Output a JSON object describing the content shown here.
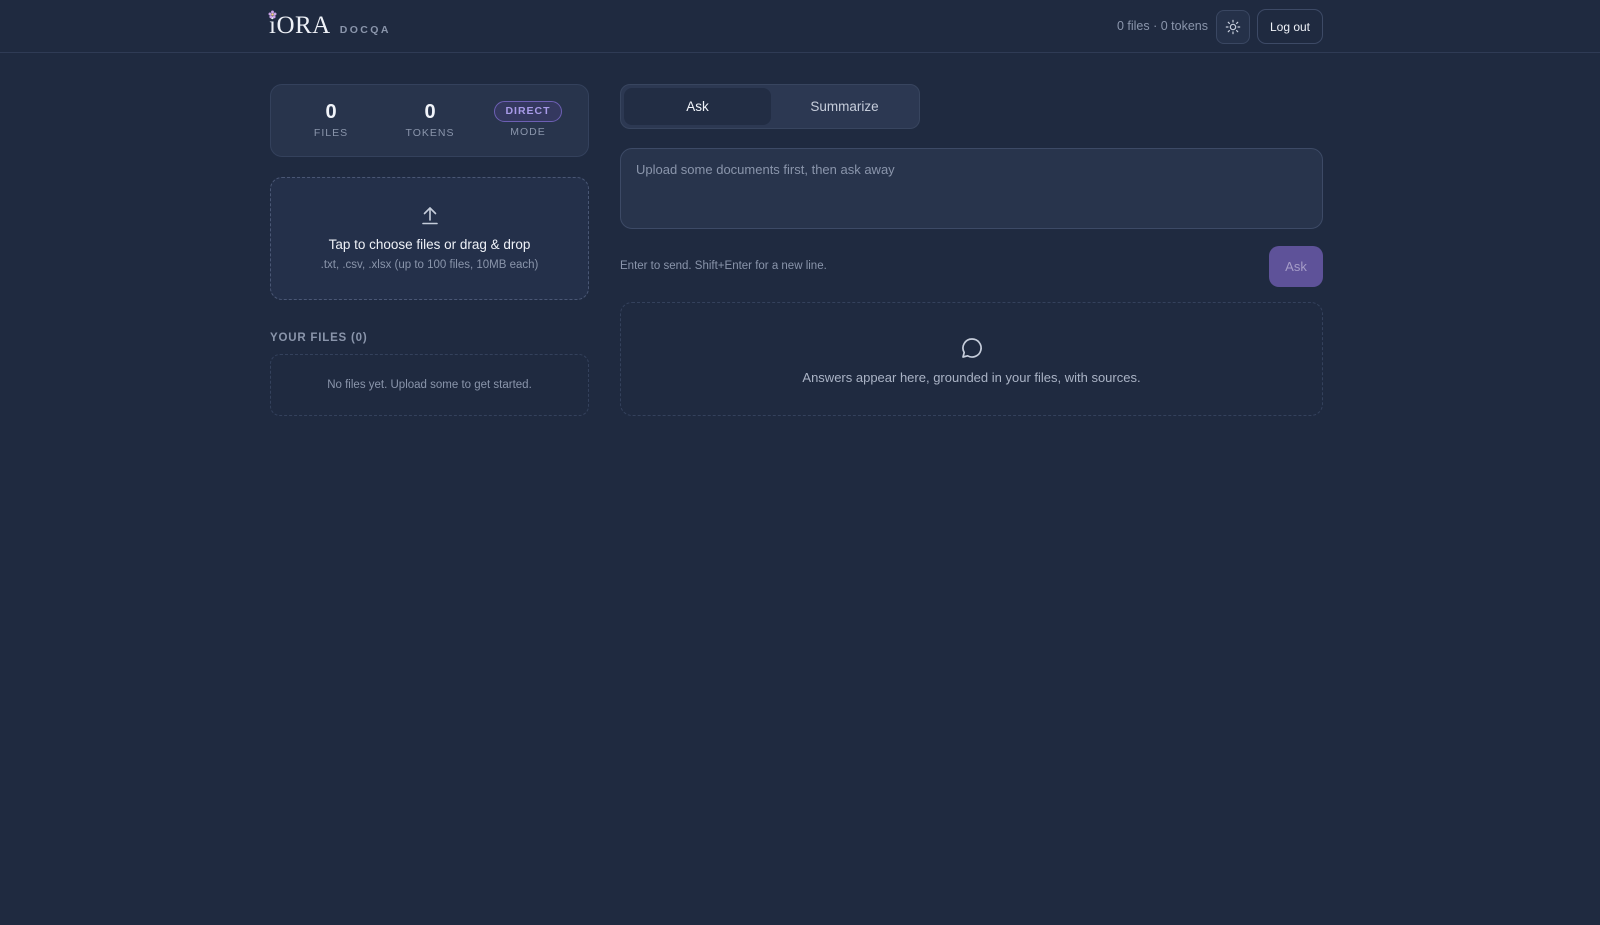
{
  "header": {
    "logo": "iORA",
    "subtitle": "DOCQA",
    "status": "0 files · 0 tokens",
    "theme_icon": "sun-icon",
    "logout_label": "Log out"
  },
  "stats": {
    "files_value": "0",
    "files_label": "FILES",
    "tokens_value": "0",
    "tokens_label": "TOKENS",
    "mode_badge": "DIRECT",
    "mode_label": "MODE"
  },
  "upload": {
    "icon": "upload-arrow-icon",
    "title": "Tap to choose files or drag & drop",
    "subtitle": ".txt, .csv, .xlsx (up to 100 files, 10MB each)"
  },
  "files": {
    "heading": "YOUR FILES (0)",
    "empty_text": "No files yet. Upload some to get started."
  },
  "tabs": [
    {
      "label": "Ask",
      "active": true
    },
    {
      "label": "Summarize",
      "active": false
    }
  ],
  "question": {
    "placeholder": "Upload some documents first, then ask away",
    "value": ""
  },
  "hint": "Enter to send. Shift+Enter for a new line.",
  "ask_button": "Ask",
  "answer": {
    "icon": "chat-bubble-icon",
    "empty_text": "Answers appear here, grounded in your files, with sources."
  },
  "colors": {
    "background": "#1f2a40",
    "accent": "#5e5299",
    "badge": "#a89be8"
  }
}
